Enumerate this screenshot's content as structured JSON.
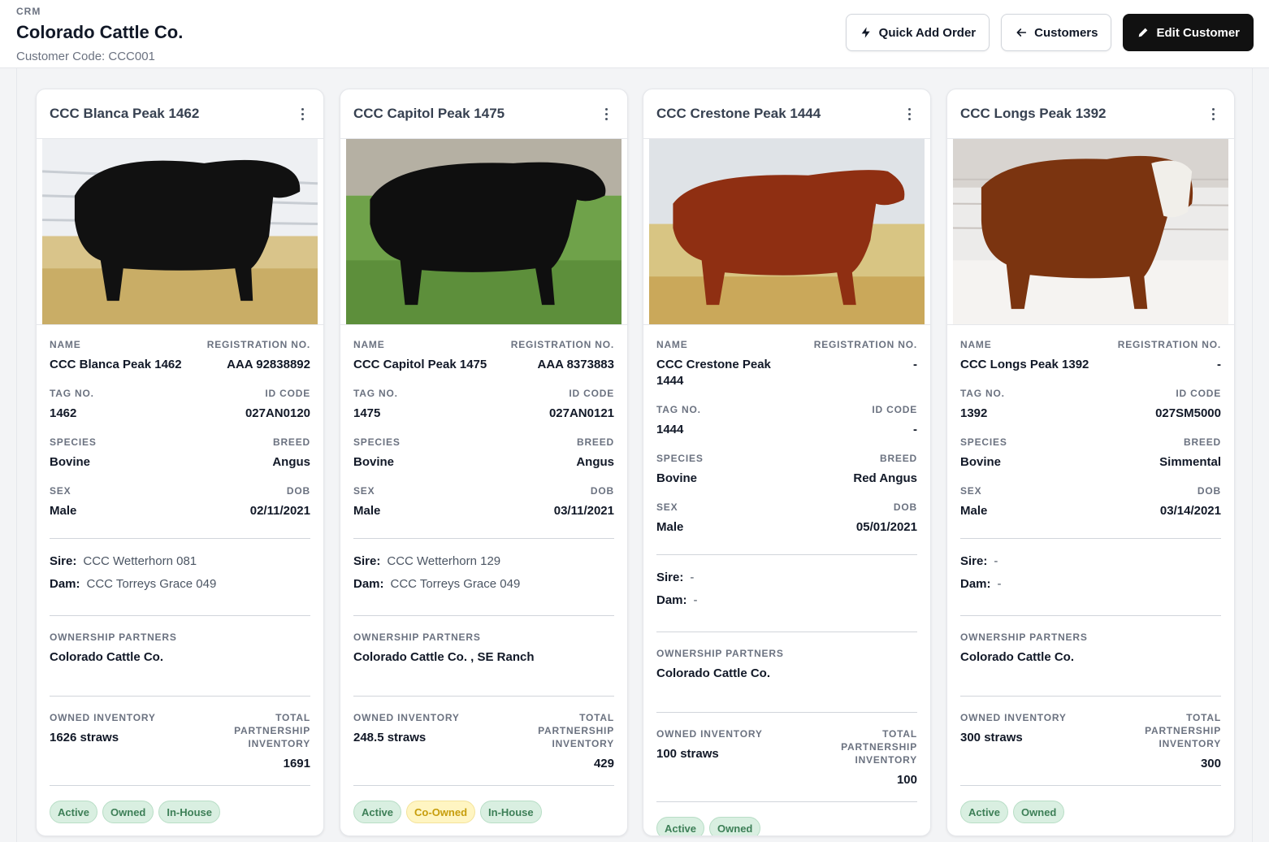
{
  "header": {
    "crumb": "CRM",
    "title": "Colorado Cattle Co.",
    "subtitle": "Customer Code: CCC001"
  },
  "actions": {
    "quick_add": "Quick Add Order",
    "customers": "Customers",
    "edit": "Edit Customer"
  },
  "labels": {
    "name": "NAME",
    "registration": "REGISTRATION NO.",
    "tag": "TAG NO.",
    "id_code": "ID CODE",
    "species": "SPECIES",
    "breed": "BREED",
    "sex": "SEX",
    "dob": "DOB",
    "sire": "Sire:",
    "dam": "Dam:",
    "owners": "OWNERSHIP PARTNERS",
    "owned_inventory": "OWNED INVENTORY",
    "total_inventory": "TOTAL PARTNERSHIP INVENTORY"
  },
  "cards": [
    {
      "title": "CCC Blanca Peak 1462",
      "name": "CCC Blanca Peak 1462",
      "registration": "AAA 92838892",
      "tag": "1462",
      "id_code": "027AN0120",
      "species": "Bovine",
      "breed": "Angus",
      "sex": "Male",
      "dob": "02/11/2021",
      "sire": "CCC Wetterhorn 081",
      "dam": "CCC Torreys Grace 049",
      "owners": "Colorado Cattle Co.",
      "owned_inventory": "1626 straws",
      "total_inventory": "1691",
      "tags": [
        "Active",
        "Owned",
        "In-House"
      ],
      "tag_colors": [
        "green",
        "green",
        "green"
      ]
    },
    {
      "title": "CCC Capitol Peak 1475",
      "name": "CCC Capitol Peak 1475",
      "registration": "AAA 8373883",
      "tag": "1475",
      "id_code": "027AN0121",
      "species": "Bovine",
      "breed": "Angus",
      "sex": "Male",
      "dob": "03/11/2021",
      "sire": "CCC Wetterhorn 129",
      "dam": "CCC Torreys Grace 049",
      "owners": "Colorado Cattle Co. , SE Ranch",
      "owned_inventory": "248.5 straws",
      "total_inventory": "429",
      "tags": [
        "Active",
        "Co-Owned",
        "In-House"
      ],
      "tag_colors": [
        "green",
        "yellow",
        "green"
      ]
    },
    {
      "title": "CCC Crestone Peak 1444",
      "name": "CCC Crestone Peak 1444",
      "registration": "-",
      "tag": "1444",
      "id_code": "-",
      "species": "Bovine",
      "breed": "Red Angus",
      "sex": "Male",
      "dob": "05/01/2021",
      "sire": "-",
      "dam": "-",
      "owners": "Colorado Cattle Co.",
      "owned_inventory": "100 straws",
      "total_inventory": "100",
      "tags": [
        "Active",
        "Owned"
      ],
      "tag_colors": [
        "green",
        "green"
      ]
    },
    {
      "title": "CCC Longs Peak 1392",
      "name": "CCC Longs Peak 1392",
      "registration": "-",
      "tag": "1392",
      "id_code": "027SM5000",
      "species": "Bovine",
      "breed": "Simmental",
      "sex": "Male",
      "dob": "03/14/2021",
      "sire": "-",
      "dam": "-",
      "owners": "Colorado Cattle Co.",
      "owned_inventory": "300 straws",
      "total_inventory": "300",
      "tags": [
        "Active",
        "Owned"
      ],
      "tag_colors": [
        "green",
        "green"
      ]
    }
  ],
  "colors": {
    "tag_green_bg": "#d9efe1",
    "tag_green_text": "#3d7f57",
    "tag_yellow_bg": "#fff5c2",
    "tag_yellow_text": "#c79d0c",
    "primary_button": "#111111"
  },
  "icons": [
    "bolt-icon",
    "arrow-left-icon",
    "pencil-icon",
    "kebab-menu-icon"
  ]
}
